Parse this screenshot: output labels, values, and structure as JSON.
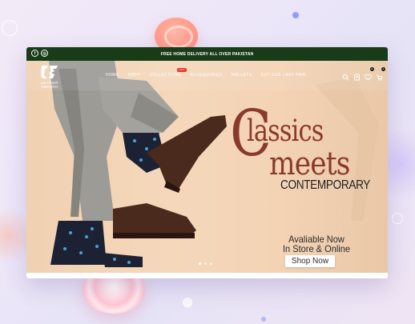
{
  "topbar": {
    "message": "FREE HOME DELIVERY ALL OVER PAKISTAN",
    "social": [
      {
        "icon": "facebook-icon",
        "glyph": "f"
      },
      {
        "icon": "instagram-icon",
        "glyph": "◎"
      }
    ]
  },
  "brand": {
    "logo_text": "LEATHER EMPORO"
  },
  "nav": {
    "items": [
      "HOME",
      "SHOP",
      "COLLECTIONS",
      "ACCESSORIES",
      "WALLETS",
      "CUT SIZE LAST PAIR"
    ],
    "hot_badge": "HOT",
    "icons": [
      "search-icon",
      "account-icon",
      "wishlist-icon",
      "cart-icon"
    ],
    "wishlist_count": "0",
    "cart_count": "0"
  },
  "hero": {
    "big_letter": "C",
    "line1": "lassics",
    "line2": "meets",
    "line3": "CONTEMPORARY",
    "avail_line1": "Avaliable Now",
    "avail_line2": "In Store & Online",
    "cta": "Shop Now",
    "slides": 3,
    "active_slide": 1
  },
  "colors": {
    "topbar": "#183c17",
    "headline": "#8a3a2c",
    "hero_bg": "#f3d3b4",
    "hot_badge": "#e53a2f"
  }
}
